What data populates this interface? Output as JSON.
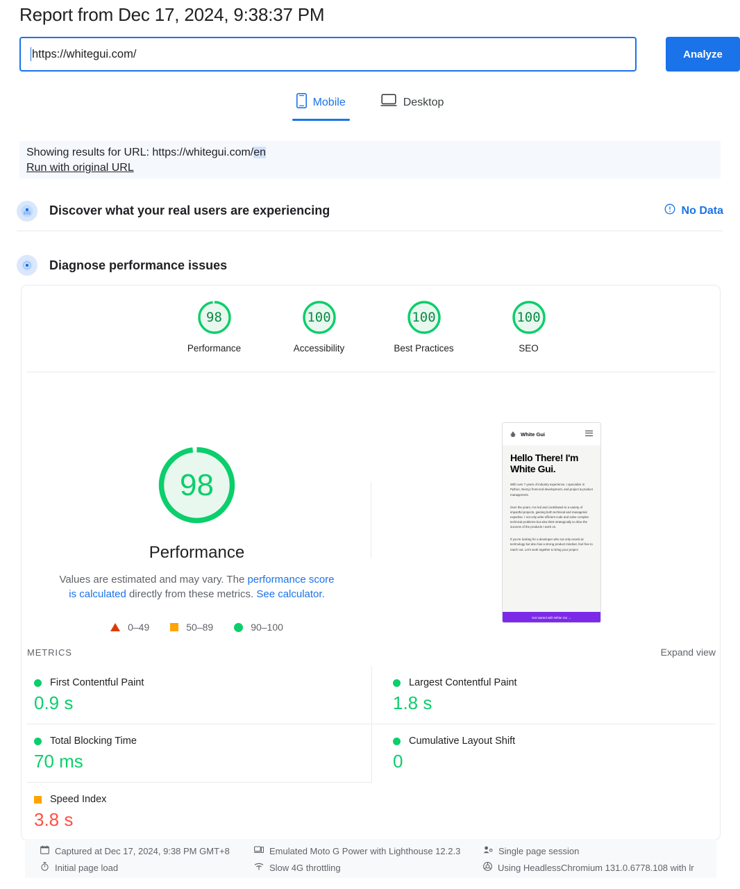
{
  "header": {
    "report_title": "Report from Dec 17, 2024, 9:38:37 PM",
    "url_value": "https://whitegui.com/",
    "analyze_label": "Analyze"
  },
  "tabs": [
    {
      "label": "Mobile",
      "icon": "mobile-phone-icon",
      "active": true
    },
    {
      "label": "Desktop",
      "icon": "desktop-monitor-icon",
      "active": false
    }
  ],
  "banner": {
    "prefix": "Showing results for URL: https://whitegui.com/",
    "highlight": "en",
    "link": "Run with original URL"
  },
  "sections": {
    "discover": {
      "title": "Discover what your real users are experiencing",
      "status": "No Data",
      "icon": "users-field-data-icon",
      "status_icon": "info-circle-icon"
    },
    "diagnose": {
      "title": "Diagnose performance issues",
      "icon": "lab-diagnostics-icon"
    }
  },
  "category_scores": [
    {
      "label": "Performance",
      "value": "98",
      "pct": 98,
      "color": "#0cce6b"
    },
    {
      "label": "Accessibility",
      "value": "100",
      "pct": 100,
      "color": "#0cce6b"
    },
    {
      "label": "Best Practices",
      "value": "100",
      "pct": 100,
      "color": "#0cce6b"
    },
    {
      "label": "SEO",
      "value": "100",
      "pct": 100,
      "color": "#0cce6b"
    }
  ],
  "performance": {
    "score": "98",
    "score_pct": 98,
    "label": "Performance",
    "desc_part1": "Values are estimated and may vary. The ",
    "desc_link1": "performance score is calculated",
    "desc_part2": " directly from these metrics. ",
    "desc_link2": "See calculator.",
    "legend": [
      {
        "shape": "triangle",
        "range": "0–49",
        "color": "#dd3b01"
      },
      {
        "shape": "square",
        "range": "50–89",
        "color": "#ffa400"
      },
      {
        "shape": "circle",
        "range": "90–100",
        "color": "#0cce6b"
      }
    ]
  },
  "thumbnail": {
    "brand": "White Gui",
    "heading": "Hello There! I'm White Gui.",
    "para1": "With over 7 years of industry experience, I specialize in Python, Next.js front-end development, and project & product management.",
    "para2": "Over the years, I've led and contributed to a variety of impactful projects, gaining both technical and managerial expertise. I not only write efficient code and solve complex technical problems but also think strategically to drive the success of the products I work on.",
    "para3": "If you're looking for a developer who not only excels at technology but also has a strong product mindset, feel free to reach out. Let's work together to bring your project",
    "cta": "Get started with White Gui →"
  },
  "metrics_section": {
    "label": "METRICS",
    "expand_view": "Expand view"
  },
  "metrics": [
    {
      "name": "First Contentful Paint",
      "value": "0.9 s",
      "status": "good",
      "marker": "circle"
    },
    {
      "name": "Largest Contentful Paint",
      "value": "1.8 s",
      "status": "good",
      "marker": "circle"
    },
    {
      "name": "Total Blocking Time",
      "value": "70 ms",
      "status": "good",
      "marker": "circle"
    },
    {
      "name": "Cumulative Layout Shift",
      "value": "0",
      "status": "good",
      "marker": "circle"
    },
    {
      "name": "Speed Index",
      "value": "3.8 s",
      "status": "avg",
      "marker": "square"
    }
  ],
  "meta": {
    "captured": "Captured at Dec 17, 2024, 9:38 PM GMT+8",
    "page_load": "Initial page load",
    "emulation": "Emulated Moto G Power with Lighthouse 12.2.3",
    "throttling": "Slow 4G throttling",
    "session": "Single page session",
    "agent": "Using HeadlessChromium 131.0.6778.108 with lr"
  },
  "colors": {
    "accent": "#1a73e8",
    "good": "#0cce6b",
    "average": "#ffa400",
    "poor": "#ff4e42",
    "text": "#202124",
    "muted": "#5f6368"
  }
}
